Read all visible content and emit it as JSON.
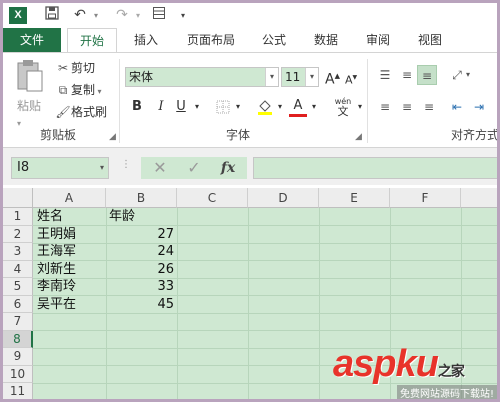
{
  "qat": {
    "app_icon": "X",
    "icons": [
      "save-icon",
      "undo-icon",
      "redo-icon",
      "form-icon",
      "customize-icon"
    ]
  },
  "tabs": [
    "文件",
    "开始",
    "插入",
    "页面布局",
    "公式",
    "数据",
    "审阅",
    "视图"
  ],
  "active_tab": "开始",
  "ribbon": {
    "clipboard": {
      "paste_label": "粘贴",
      "cut_label": "剪切",
      "copy_label": "复制",
      "format_painter_label": "格式刷",
      "group_label": "剪贴板"
    },
    "font": {
      "font_name": "宋体",
      "font_size": "11",
      "grow_label": "A",
      "shrink_label": "A",
      "bold": "B",
      "italic": "I",
      "underline": "U",
      "wen": "wén",
      "wen_char": "文",
      "font_color_label": "A",
      "fill_label": "",
      "group_label": "字体"
    },
    "alignment": {
      "group_label": "对齐方式"
    }
  },
  "formula_bar": {
    "name_box": "I8",
    "cancel_symbol": "✕",
    "enter_symbol": "✓",
    "fx_label": "fx",
    "value": ""
  },
  "sheet": {
    "columns": [
      "A",
      "B",
      "C",
      "D",
      "E",
      "F"
    ],
    "rows": [
      "1",
      "2",
      "3",
      "4",
      "5",
      "6",
      "7",
      "8",
      "9",
      "10",
      "11"
    ],
    "selected_row": "8",
    "cells": [
      [
        "姓名",
        "年龄"
      ],
      [
        "王明娟",
        "27"
      ],
      [
        "王海军",
        "24"
      ],
      [
        "刘新生",
        "26"
      ],
      [
        "李南玲",
        "33"
      ],
      [
        "吴平在",
        "45"
      ]
    ]
  },
  "watermark": {
    "main": "aspku",
    "suffix": "之家",
    "sub": "免费网站源码下载站!"
  },
  "colors": {
    "excel_green": "#217346",
    "cell_bg": "#cfe8d2",
    "watermark_red": "#e8332a"
  }
}
